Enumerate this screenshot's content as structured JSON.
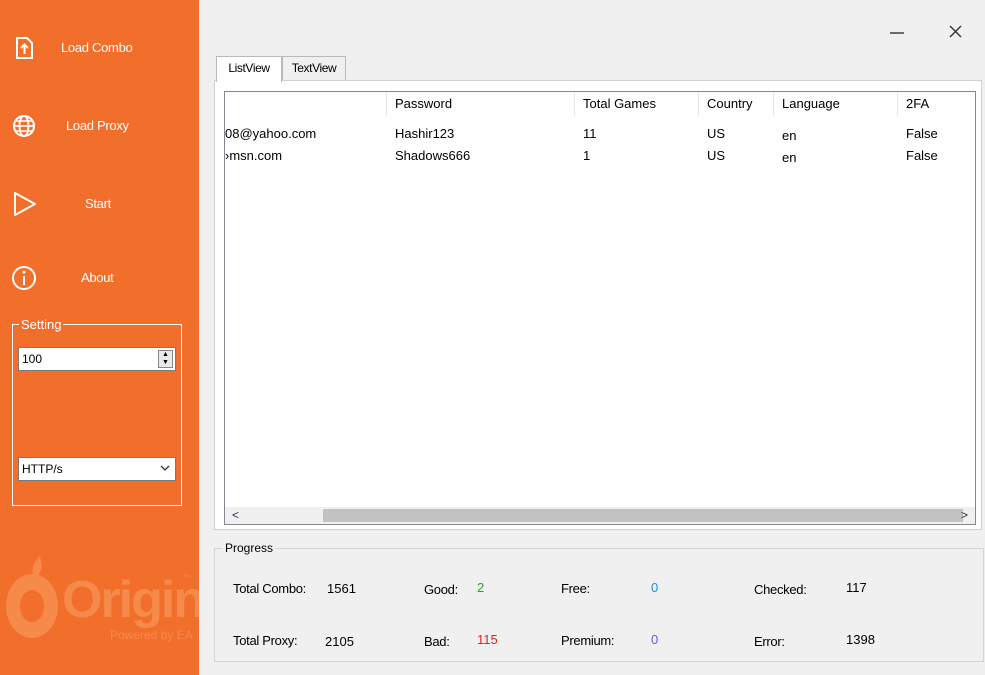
{
  "sidebar": {
    "items": [
      {
        "label": "Load Combo",
        "icon": "upload-file-icon"
      },
      {
        "label": "Load Proxy",
        "icon": "globe-icon"
      },
      {
        "label": "Start",
        "icon": "play-icon"
      },
      {
        "label": "About",
        "icon": "info-icon"
      }
    ],
    "setting": {
      "legend": "Setting",
      "threads_value": "100",
      "proxy_type": "HTTP/s"
    },
    "logo": {
      "text": "Origin",
      "subtitle": "Powered by EA",
      "tm": "™"
    }
  },
  "window": {
    "minimize": "—",
    "close": "✕"
  },
  "tabs": [
    {
      "label": "ListView",
      "active": true
    },
    {
      "label": "TextView",
      "active": false
    }
  ],
  "listview": {
    "columns": [
      "",
      "Password",
      "Total Games",
      "Country",
      "Language",
      "2FA"
    ],
    "rows": [
      [
        "08@yahoo.com",
        "Hashir123",
        "11",
        "US",
        "en",
        "False"
      ],
      [
        "›msn.com",
        "Shadows666",
        "1",
        "US",
        "en",
        "False"
      ]
    ],
    "scroll_left": "<",
    "scroll_right": ">"
  },
  "progress": {
    "legend": "Progress",
    "total_combo_label": "Total Combo:",
    "total_combo": "1561",
    "total_proxy_label": "Total Proxy:",
    "total_proxy": "2105",
    "good_label": "Good:",
    "good": "2",
    "bad_label": "Bad:",
    "bad": "115",
    "free_label": "Free:",
    "free": "0",
    "premium_label": "Premium:",
    "premium": "0",
    "checked_label": "Checked:",
    "checked": "117",
    "error_label": "Error:",
    "error": "1398"
  },
  "colors": {
    "sidebar": "#f26e2b",
    "good": "#2e9e2e",
    "bad": "#e0201c",
    "free": "#1f8fdc",
    "premium": "#7b4fd6"
  }
}
